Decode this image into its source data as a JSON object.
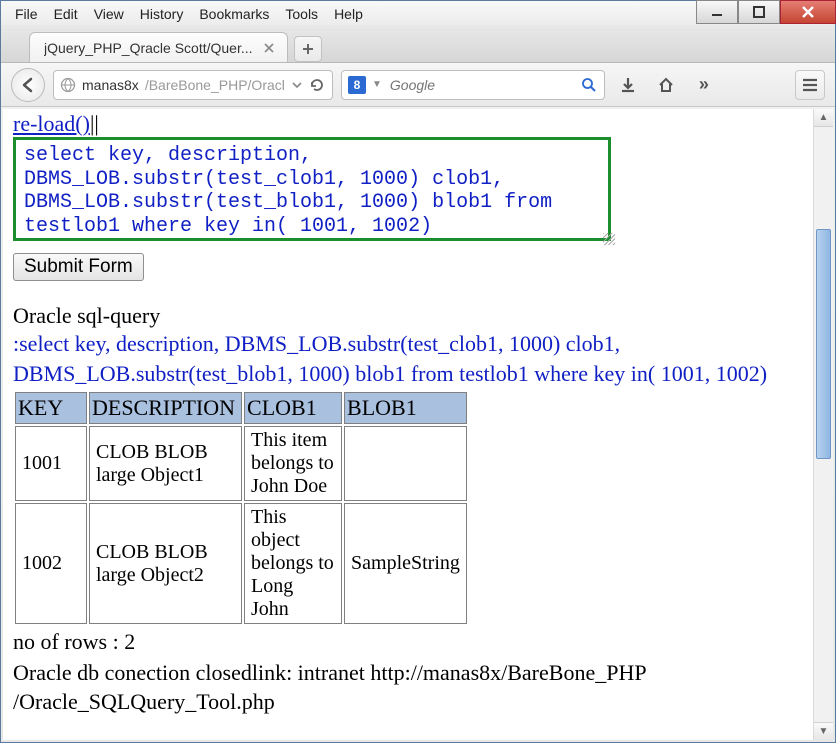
{
  "menubar": {
    "file": "File",
    "edit": "Edit",
    "view": "View",
    "history": "History",
    "bookmarks": "Bookmarks",
    "tools": "Tools",
    "help": "Help"
  },
  "tab": {
    "title": "jQuery_PHP_Qracle Scott/Quer..."
  },
  "nav": {
    "url_primary": "manas8x",
    "url_secondary": "/BareBone_PHP/Oracl",
    "search_engine": "8",
    "search_engine_label": "Google",
    "search_placeholder": "Google"
  },
  "page": {
    "reload_link": "re-load()",
    "sep": "||",
    "sql_input": "select key, description, DBMS_LOB.substr(test_clob1, 1000) clob1, DBMS_LOB.substr(test_blob1, 1000) blob1 from testlob1 where key in( 1001, 1002)",
    "submit_label": "Submit Form",
    "query_label": "Oracle sql-query",
    "echoed_sql": ":select key, description, DBMS_LOB.substr(test_clob1, 1000) clob1, DBMS_LOB.substr(test_blob1, 1000) blob1 from testlob1 where key in( 1001, 1002)",
    "row_count_label": "no of rows : 2",
    "footer_text": "Oracle db conection closedlink: intranet http://manas8x/BareBone_PHP /Oracle_SQLQuery_Tool.php"
  },
  "table": {
    "headers": {
      "c0": "KEY",
      "c1": "DESCRIPTION",
      "c2": "CLOB1",
      "c3": "BLOB1"
    },
    "rows": [
      {
        "c0": "1001",
        "c1": "CLOB BLOB large Object1",
        "c2": "This item belongs to John Doe",
        "c3": ""
      },
      {
        "c0": "1002",
        "c1": "CLOB BLOB large Object2",
        "c2": "This object belongs to Long John",
        "c3": "SampleString"
      }
    ]
  }
}
